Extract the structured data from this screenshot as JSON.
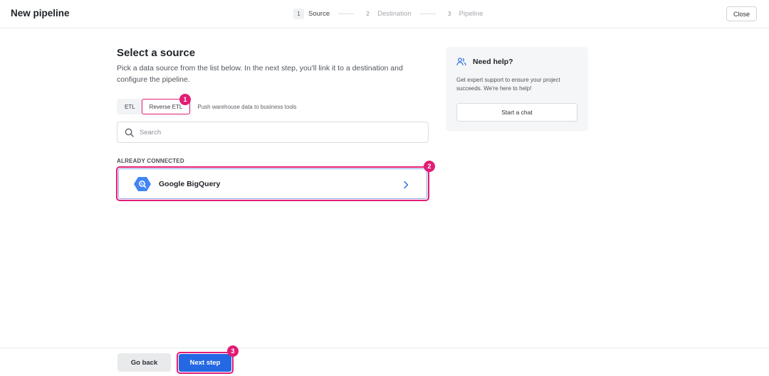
{
  "header": {
    "title": "New pipeline",
    "steps": [
      {
        "num": "1",
        "label": "Source"
      },
      {
        "num": "2",
        "label": "Destination"
      },
      {
        "num": "3",
        "label": "Pipeline"
      }
    ],
    "close_label": "Close"
  },
  "main": {
    "title": "Select a source",
    "description": "Pick a data source from the list below. In the next step, you'll link it to a destination and configure the pipeline.",
    "tabs": [
      {
        "label": "ETL"
      },
      {
        "label": "Reverse ETL"
      }
    ],
    "tab_hint": "Push warehouse data to business tools",
    "search": {
      "placeholder": "Search",
      "value": ""
    },
    "section_label": "ALREADY CONNECTED",
    "connected_sources": [
      {
        "name": "Google BigQuery",
        "icon": "bigquery-icon"
      }
    ]
  },
  "help": {
    "title": "Need help?",
    "description": "Get expert support to ensure your project succeeds. We're here to help!",
    "button_label": "Start a chat",
    "icon": "users-icon"
  },
  "footer": {
    "back_label": "Go back",
    "next_label": "Next step"
  },
  "annotations": [
    "1",
    "2",
    "3"
  ],
  "colors": {
    "accent": "#2468e4",
    "highlight": "#e11d74",
    "bigquery": "#4285f4"
  }
}
